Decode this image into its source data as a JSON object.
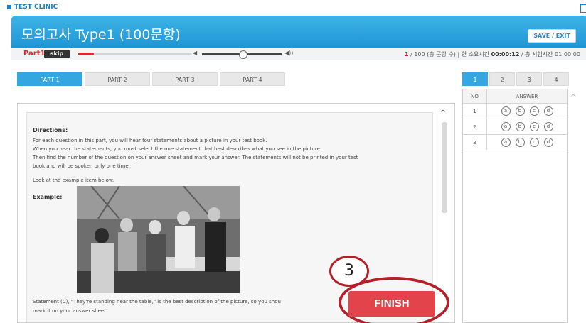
{
  "app": {
    "brand": "TEST CLINIC"
  },
  "header": {
    "title": "모의고사 Type1 (100문항)",
    "save_label": "SAVE / EXIT"
  },
  "player": {
    "part_label": "Part1",
    "skip_label": "skip",
    "progress": 0.14,
    "question_current": "1",
    "question_rest": " / 100 (총 문항 수)  |  현 소요시간 ",
    "elapsed": "00:00:12",
    "exam_time": " / 총 시험시간 01:00:00"
  },
  "part_tabs": [
    {
      "label": "PART 1",
      "active": true
    },
    {
      "label": "PART 2",
      "active": false
    },
    {
      "label": "PART 3",
      "active": false
    },
    {
      "label": "PART 4",
      "active": false
    }
  ],
  "question": {
    "directions_title": "Directions:",
    "directions_lines": [
      "For each question in this part, you will hear four statements about a picture in your test book.",
      "When you hear the statements, you must select the one statement that best describes what you see in the picture.",
      "Then find the number of the question on your answer sheet and mark your answer. The statements will not be printed in your test",
      "book and will be spoken only one time."
    ],
    "look_text": "Look at the example item below.",
    "example_label": "Example:",
    "statement_line1": "Statement (C), \"They're standing near the table,\" is the best description of the picture, so you shou",
    "statement_line2": "mark it on your answer sheet."
  },
  "overlay": {
    "step_number": "3",
    "finish_label": "FINISH"
  },
  "answer_sheet": {
    "page_tabs": [
      {
        "label": "1",
        "active": true
      },
      {
        "label": "2",
        "active": false
      },
      {
        "label": "3",
        "active": false
      },
      {
        "label": "4",
        "active": false
      }
    ],
    "col_no": "NO",
    "col_answer": "ANSWER",
    "rows": [
      {
        "no": "1",
        "options": [
          "a",
          "b",
          "c",
          "d"
        ]
      },
      {
        "no": "2",
        "options": [
          "a",
          "b",
          "c",
          "d"
        ]
      },
      {
        "no": "3",
        "options": [
          "a",
          "b",
          "c",
          "d"
        ]
      }
    ]
  },
  "colors": {
    "accent": "#35a7e0",
    "danger": "#d7282f",
    "ring": "#b3202a"
  }
}
